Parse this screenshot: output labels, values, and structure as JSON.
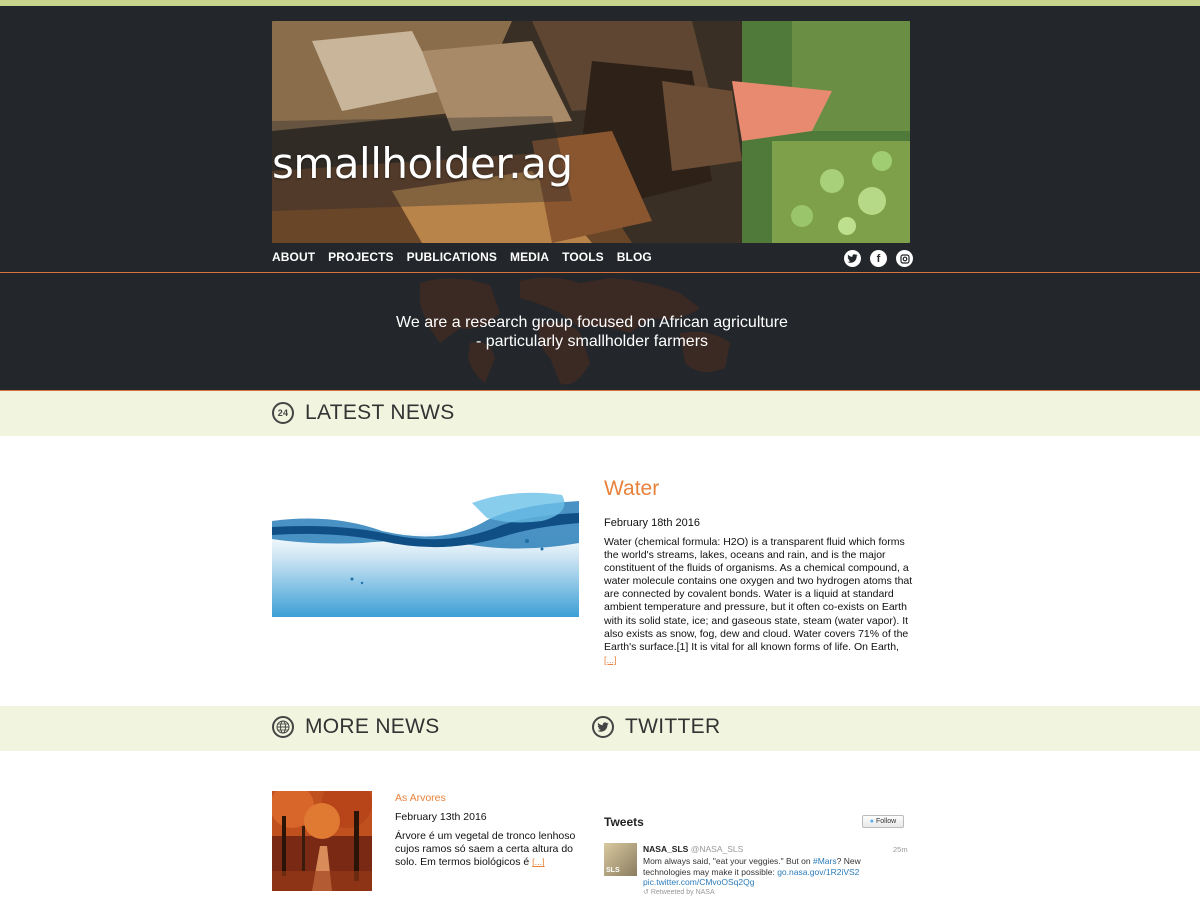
{
  "site": {
    "title": "smallholder.ag",
    "accent_color": "#e8823c",
    "top_line_color": "#c8d48c",
    "header_bg": "#23262a",
    "band_bg": "#f1f5df"
  },
  "nav": {
    "items": [
      "ABOUT",
      "PROJECTS",
      "PUBLICATIONS",
      "MEDIA",
      "TOOLS",
      "BLOG"
    ]
  },
  "social": {
    "icons": [
      "twitter-icon",
      "facebook-icon",
      "instagram-icon"
    ]
  },
  "tagline": {
    "line1": "We are a research group focused on African agriculture",
    "line2": "- particularly smallholder farmers"
  },
  "latest_news": {
    "heading": "LATEST NEWS",
    "icon_text": "24",
    "article": {
      "title": "Water",
      "date": "February 18th 2016",
      "body": "Water (chemical formula: H2O) is a transparent fluid which forms the world's streams, lakes, oceans and rain, and is the major constituent of the fluids of organisms. As a chemical compound, a water molecule contains one oxygen and two hydrogen atoms that are connected by covalent bonds. Water is a liquid at standard ambient temperature and pressure, but it often co-exists on Earth with its solid state, ice; and gaseous state, steam (water vapor). It also exists as snow, fog, dew and cloud. Water covers 71% of the Earth's surface.[1] It is vital for all known forms of life. On Earth,",
      "more": "[...]"
    }
  },
  "more_news": {
    "heading": "MORE NEWS",
    "article": {
      "title": "As Arvores",
      "date": "February 13th 2016",
      "body": "Árvore é um vegetal de tronco lenhoso cujos ramos só saem a certa altura do solo. Em termos biológicos é",
      "more": "[...]"
    }
  },
  "twitter": {
    "heading": "TWITTER",
    "widget_title": "Tweets",
    "follow_label": "Follow",
    "tweet": {
      "name": "NASA_SLS",
      "handle": "@NASA_SLS",
      "time": "25m",
      "text_1": "Mom always said, \"eat your veggies.\" But on ",
      "hashtag": "#Mars",
      "text_2": "? New technologies may make it possible: ",
      "link": "go.nasa.gov/1R2iVS2",
      "pic": "pic.twitter.com/CMvoOSq2Qg",
      "retweeted_by": "Retweeted by NASA",
      "avatar_text": "SLS"
    }
  }
}
